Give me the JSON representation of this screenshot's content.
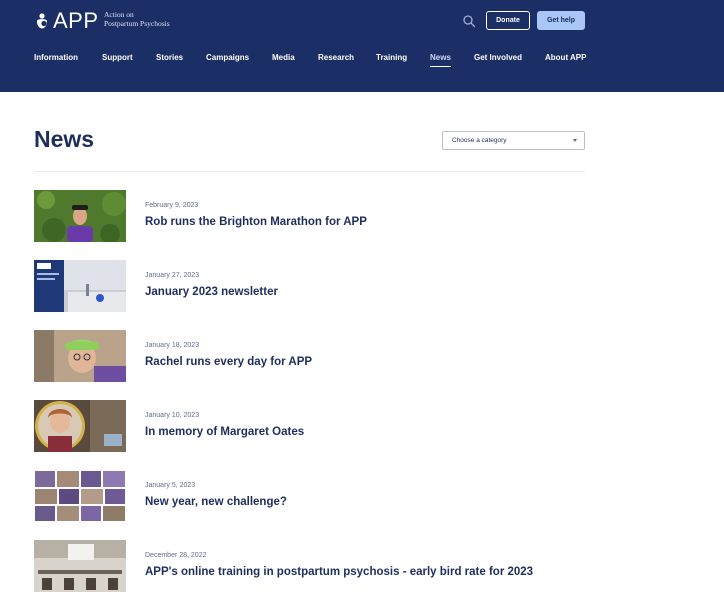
{
  "header": {
    "logo_text": "APP",
    "tagline_line1": "Action on",
    "tagline_line2": "Postpartum Psychosis",
    "donate_label": "Donate",
    "help_label": "Get help",
    "search_icon": "search-icon"
  },
  "nav": {
    "items": [
      {
        "label": "Information"
      },
      {
        "label": "Support"
      },
      {
        "label": "Stories"
      },
      {
        "label": "Campaigns"
      },
      {
        "label": "Media"
      },
      {
        "label": "Research"
      },
      {
        "label": "Training"
      },
      {
        "label": "News",
        "active": true
      },
      {
        "label": "Get Involved"
      },
      {
        "label": "About APP"
      }
    ]
  },
  "main": {
    "title": "News",
    "category_select": {
      "selected": "Choose a category"
    }
  },
  "news": [
    {
      "date": "February 9, 2023",
      "title": "Rob runs the Brighton Marathon for APP"
    },
    {
      "date": "January 27, 2023",
      "title": "January 2023 newsletter"
    },
    {
      "date": "January 18, 2023",
      "title": "Rachel runs every day for APP"
    },
    {
      "date": "January 10, 2023",
      "title": "In memory of Margaret Oates"
    },
    {
      "date": "January 5, 2023",
      "title": "New year, new challenge?"
    },
    {
      "date": "December 28, 2022",
      "title": "APP's online training in postpartum psychosis - early bird rate for 2023"
    }
  ],
  "colors": {
    "header_bg": "#1b2e66",
    "text_navy": "#1e2e5c",
    "help_button": "#a9c6f7"
  }
}
